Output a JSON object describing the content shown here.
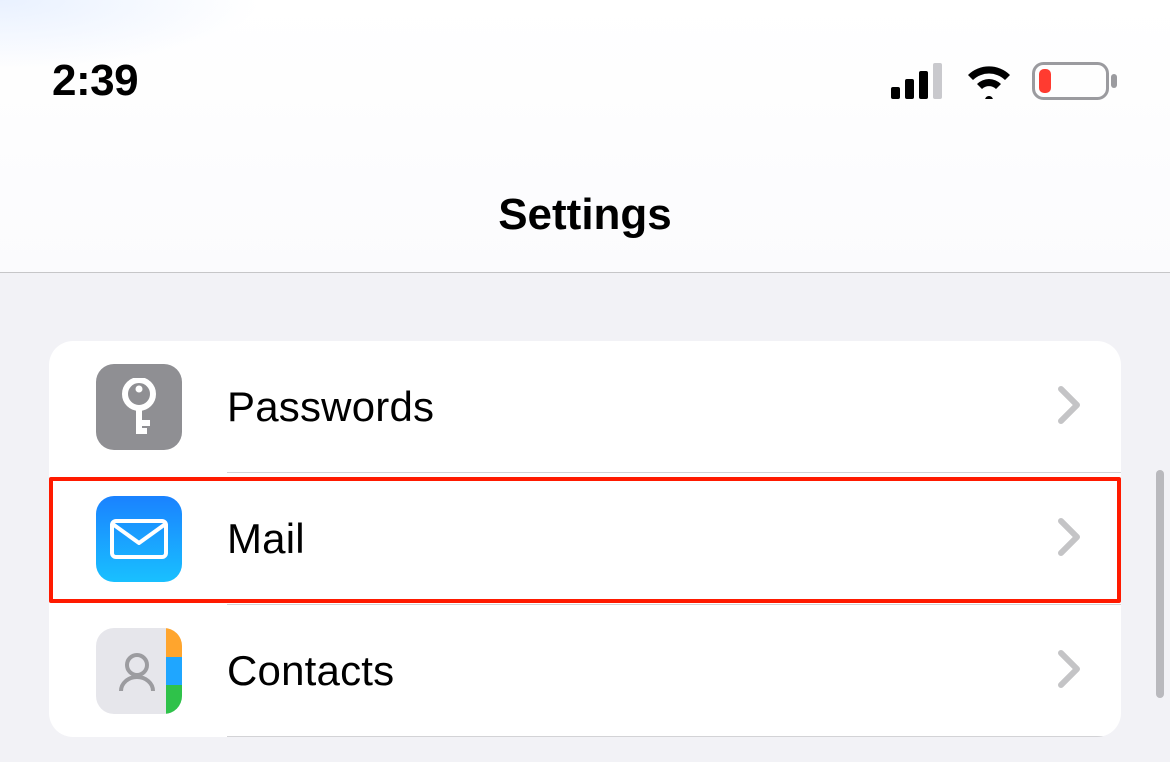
{
  "status_bar": {
    "time": "2:39",
    "signal_bars": 3,
    "battery_low": true
  },
  "header": {
    "title": "Settings"
  },
  "rows": [
    {
      "id": "passwords",
      "label": "Passwords"
    },
    {
      "id": "mail",
      "label": "Mail"
    },
    {
      "id": "contacts",
      "label": "Contacts"
    }
  ],
  "highlight": {
    "row_id": "mail",
    "color": "#ff1a00"
  }
}
